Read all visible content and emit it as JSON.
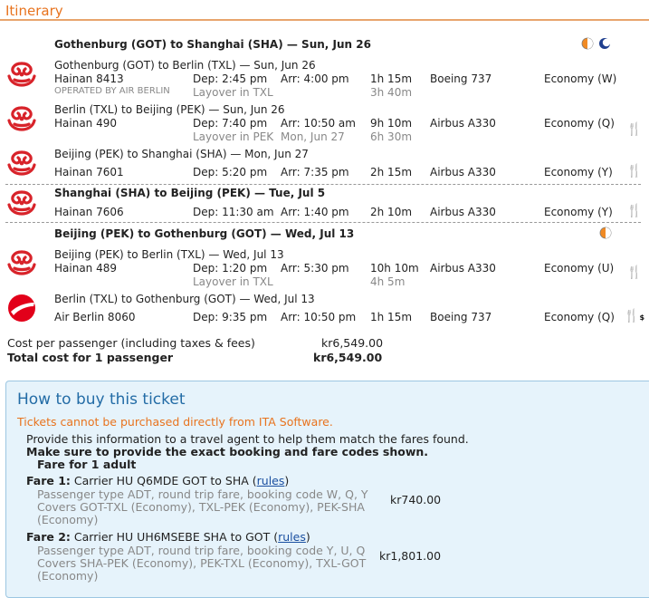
{
  "header": {
    "title": "Itinerary"
  },
  "colors": {
    "accent": "#e8731e",
    "hainan_red": "#d8232a",
    "airberlin_red": "#e2001a",
    "box_blue": "#e6f3fb",
    "link": "#1a4fa0"
  },
  "icons": {
    "hainan": "hainan-airlines-logo-icon",
    "airberlin": "air-berlin-logo-icon",
    "day": "day-night-icon",
    "night": "moon-icon",
    "meal": "fork-knife-icon"
  },
  "slices": [
    {
      "title": "Gothenburg (GOT) to Shanghai (SHA) — Sun, Jun 26"
    },
    {
      "title": "Shanghai (SHA) to Beijing (PEK) — Tue, Jul 5"
    },
    {
      "title": "Beijing (PEK) to Gothenburg (GOT) — Wed, Jul 13"
    }
  ],
  "flights": [
    {
      "route": "Gothenburg (GOT) to Berlin (TXL) — Sun, Jun 26",
      "flight": "Hainan 8413",
      "dep": "Dep: 2:45 pm",
      "arr": "Arr: 4:00 pm",
      "duration": "1h 15m",
      "aircraft": "Boeing 737",
      "cabin": "Economy (W)",
      "operated": "OPERATED BY AIR BERLIN",
      "layover": "Layover in TXL",
      "layover_date": "",
      "layover_time": "3h 40m"
    },
    {
      "route": "Berlin (TXL) to Beijing (PEK) — Sun, Jun 26",
      "flight": "Hainan 490",
      "dep": "Dep: 7:40 pm",
      "arr": "Arr: 10:50 am",
      "duration": "9h 10m",
      "aircraft": "Airbus A330",
      "cabin": "Economy (Q)",
      "layover": "Layover in PEK",
      "layover_date": "Mon, Jun 27",
      "layover_time": "6h 30m"
    },
    {
      "route": "Beijing (PEK) to Shanghai (SHA) — Mon, Jun 27",
      "flight": "Hainan 7601",
      "dep": "Dep: 5:20 pm",
      "arr": "Arr: 7:35 pm",
      "duration": "2h 15m",
      "aircraft": "Airbus A330",
      "cabin": "Economy (Y)"
    },
    {
      "flight": "Hainan 7606",
      "dep": "Dep: 11:30 am",
      "arr": "Arr: 1:40 pm",
      "duration": "2h 10m",
      "aircraft": "Airbus A330",
      "cabin": "Economy (Y)"
    },
    {
      "route": "Beijing (PEK) to Berlin (TXL) — Wed, Jul 13",
      "flight": "Hainan 489",
      "dep": "Dep: 1:20 pm",
      "arr": "Arr: 5:30 pm",
      "duration": "10h 10m",
      "aircraft": "Airbus A330",
      "cabin": "Economy (U)",
      "layover": "Layover in TXL",
      "layover_time": "4h 5m"
    },
    {
      "route": "Berlin (TXL) to Gothenburg (GOT) — Wed, Jul 13",
      "flight": "Air Berlin 8060",
      "dep": "Dep: 9:35 pm",
      "arr": "Arr: 10:50 pm",
      "duration": "1h 15m",
      "aircraft": "Boeing 737",
      "cabin": "Economy (Q)",
      "meal_suffix": "$"
    }
  ],
  "cost": {
    "per_label": "Cost per passenger (including taxes & fees)",
    "per_value": "kr6,549.00",
    "total_label": "Total cost for 1 passenger",
    "total_value": "kr6,549.00"
  },
  "buy": {
    "title": "How to buy this ticket",
    "warning": "Tickets cannot be purchased directly from ITA Software.",
    "line1": "Provide this information to a travel agent to help them match the fares found.",
    "line2": "Make sure to provide the exact booking and fare codes shown.",
    "line3": "Fare for 1 adult",
    "fares": [
      {
        "label": "Fare 1:",
        "carrier": "Carrier HU Q6MDE GOT to SHA (",
        "rules": "rules",
        "close": ")",
        "desc1": "Passenger type ADT, round trip fare, booking code W, Q, Y",
        "desc2": "Covers GOT-TXL (Economy), TXL-PEK (Economy), PEK-SHA",
        "desc3": "(Economy)",
        "price": "kr740.00"
      },
      {
        "label": "Fare 2:",
        "carrier": "Carrier HU UH6MSEBE SHA to GOT (",
        "rules": "rules",
        "close": ")",
        "desc1": "Passenger type ADT, round trip fare, booking code Y, U, Q",
        "desc2": "Covers SHA-PEK (Economy), PEK-TXL (Economy), TXL-GOT",
        "desc3": "(Economy)",
        "price": "kr1,801.00"
      }
    ]
  }
}
